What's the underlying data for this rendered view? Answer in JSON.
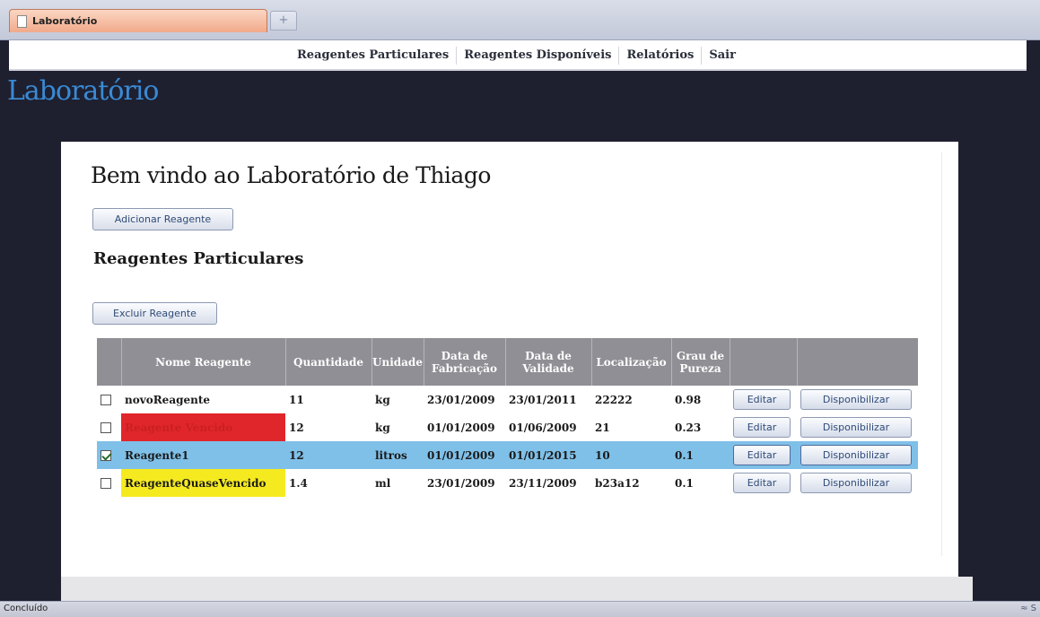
{
  "browser": {
    "tab_title": "Laboratório",
    "new_tab_symbol": "+",
    "status": "Concluído",
    "status_right": "≈ S"
  },
  "nav": {
    "items": [
      "Reagentes Particulares",
      "Reagentes Disponíveis",
      "Relatórios",
      "Sair"
    ]
  },
  "site_title": "Laboratório",
  "main": {
    "welcome": "Bem vindo ao Laboratório de Thiago",
    "add_button": "Adicionar Reagente",
    "section_title": "Reagentes Particulares",
    "delete_button": "Excluir Reagente",
    "columns": {
      "nome": "Nome Reagente",
      "quantidade": "Quantidade",
      "unidade": "Unidade",
      "fabricacao": "Data de Fabricação",
      "validade": "Data de Validade",
      "localizacao": "Localização",
      "pureza": "Grau de Pureza"
    },
    "rows": [
      {
        "checked": false,
        "highlight": "none",
        "nome": "novoReagente",
        "quantidade": "11",
        "unidade": "kg",
        "fabricacao": "23/01/2009",
        "validade": "23/01/2011",
        "localizacao": "22222",
        "pureza": "0.98",
        "edit": "Editar",
        "disp": "Disponibilizar"
      },
      {
        "checked": false,
        "highlight": "red",
        "nome": "Reagente Vencido",
        "quantidade": "12",
        "unidade": "kg",
        "fabricacao": "01/01/2009",
        "validade": "01/06/2009",
        "localizacao": "21",
        "pureza": "0.23",
        "edit": "Editar",
        "disp": "Disponibilizar"
      },
      {
        "checked": true,
        "highlight": "selected",
        "nome": "Reagente1",
        "quantidade": "12",
        "unidade": "litros",
        "fabricacao": "01/01/2009",
        "validade": "01/01/2015",
        "localizacao": "10",
        "pureza": "0.1",
        "edit": "Editar",
        "disp": "Disponibilizar"
      },
      {
        "checked": false,
        "highlight": "yellow",
        "nome": "ReagenteQuaseVencido",
        "quantidade": "1.4",
        "unidade": "ml",
        "fabricacao": "23/01/2009",
        "validade": "23/11/2009",
        "localizacao": "b23a12",
        "pureza": "0.1",
        "edit": "Editar",
        "disp": "Disponibilizar"
      }
    ]
  },
  "colors": {
    "title_blue": "#3a8ad4",
    "selected_row": "#7fc0e8",
    "expired": "#e1262b",
    "near_expiry": "#f5ea1f",
    "header_gray": "#8f8f95"
  }
}
